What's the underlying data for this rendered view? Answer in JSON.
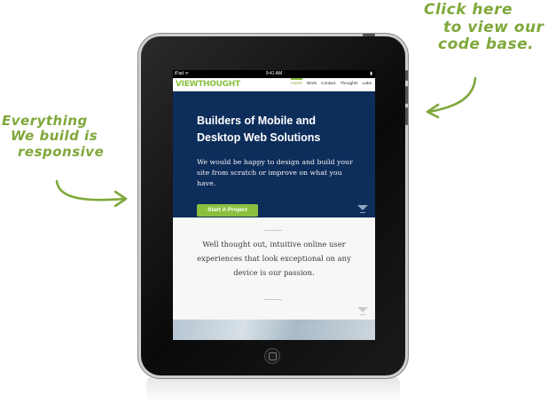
{
  "annotations": {
    "right_note": [
      "Click here",
      "to view our",
      "code base."
    ],
    "left_note": [
      "Everything",
      "We build is",
      "responsive"
    ]
  },
  "device": {
    "statusbar": {
      "carrier": "iPad ᯤ",
      "time": "9:41 AM",
      "battery": "▮"
    }
  },
  "site": {
    "logo": "VIEWTHOUGHT",
    "nav": [
      "Home",
      "Work",
      "Contact",
      "Thoughts",
      "Labs"
    ],
    "active_nav": "Home",
    "hero": {
      "heading": "Builders of Mobile and Desktop Web Solutions",
      "body": "We would be happy to design and build your site from scratch or improve on what you have.",
      "cta_label": "Start A Project",
      "scroll_label": "scroll"
    },
    "section": {
      "tagline": "Well thought out, intuitive online user experiences that look exceptional on any device is our passion."
    }
  },
  "colors": {
    "accent": "#8bc03f",
    "hero_bg": "#0d2d5b",
    "annotation": "#7fa83a"
  }
}
